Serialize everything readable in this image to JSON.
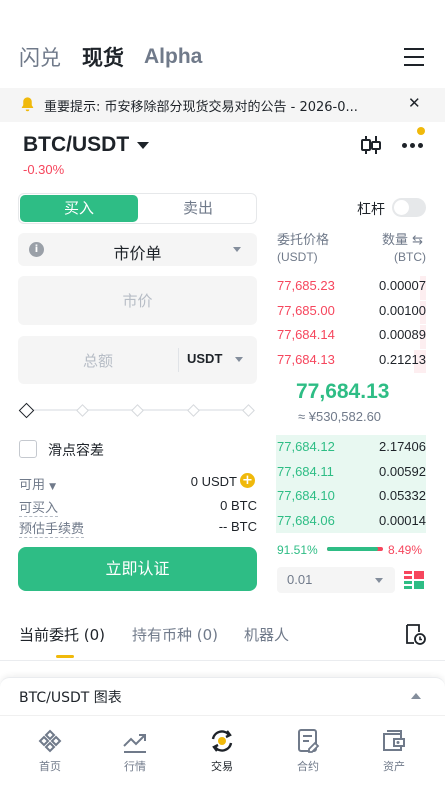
{
  "top_tabs": {
    "flash": "闪兑",
    "spot": "现货",
    "alpha": "Alpha"
  },
  "notice": {
    "text": "重要提示: 币安移除部分现货交易对的公告 - 2026-0..."
  },
  "pair": {
    "symbol": "BTC/USDT",
    "change": "-0.30%"
  },
  "trade": {
    "buy_label": "买入",
    "sell_label": "卖出",
    "leverage_label": "杠杆",
    "order_type": "市价单",
    "price_placeholder": "市价",
    "total_placeholder": "总额",
    "total_currency": "USDT",
    "slippage_label": "滑点容差",
    "available_label": "可用",
    "available_value": "0 USDT",
    "can_buy_label": "可买入",
    "can_buy_value": "0 BTC",
    "fee_label": "预估手续费",
    "fee_value": "-- BTC",
    "cta_label": "立即认证"
  },
  "orderbook": {
    "price_header": "委托价格",
    "price_unit": "(USDT)",
    "qty_header": "数量",
    "qty_unit": "(BTC)",
    "asks": [
      {
        "price": "77,685.23",
        "qty": "0.00007",
        "depth": 0.04
      },
      {
        "price": "77,685.00",
        "qty": "0.00100",
        "depth": 0.04
      },
      {
        "price": "77,684.14",
        "qty": "0.00089",
        "depth": 0.04
      },
      {
        "price": "77,684.13",
        "qty": "0.21213",
        "depth": 0.08
      }
    ],
    "last_price": "77,684.13",
    "last_price_fiat": "≈ ¥530,582.60",
    "bids": [
      {
        "price": "77,684.12",
        "qty": "2.17406",
        "depth": 1.0
      },
      {
        "price": "77,684.11",
        "qty": "0.00592",
        "depth": 1.0
      },
      {
        "price": "77,684.10",
        "qty": "0.05332",
        "depth": 1.0
      },
      {
        "price": "77,684.06",
        "qty": "0.00014",
        "depth": 1.0
      }
    ],
    "buy_ratio": "91.51%",
    "sell_ratio": "8.49%",
    "buy_ratio_value": 0.9151,
    "precision": "0.01"
  },
  "orders_tabs": {
    "open": "当前委托 (0)",
    "holdings": "持有币种 (0)",
    "bots": "机器人"
  },
  "chart_bar": {
    "label": "BTC/USDT 图表"
  },
  "nav": {
    "home": "首页",
    "markets": "行情",
    "trade": "交易",
    "futures": "合约",
    "assets": "资产"
  },
  "colors": {
    "green": "#2ebd85",
    "red": "#f6465d",
    "yellow": "#f0b90b"
  }
}
